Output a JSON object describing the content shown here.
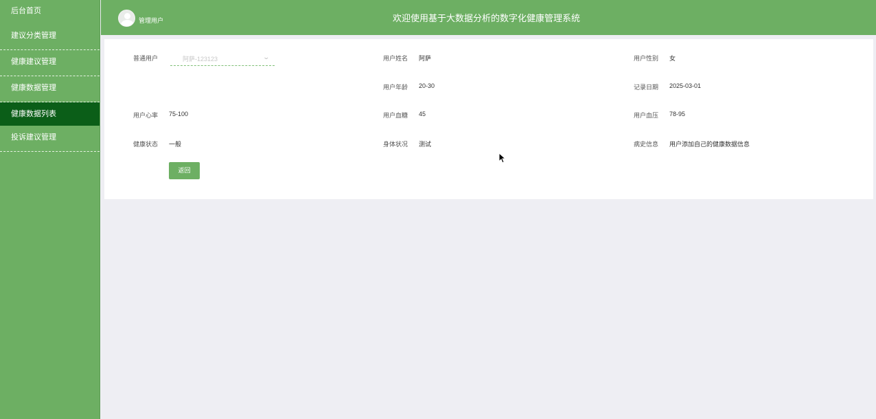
{
  "sidebar": {
    "items": [
      {
        "label": "后台首页"
      },
      {
        "label": "建议分类管理"
      },
      {
        "label": "健康建议管理"
      },
      {
        "label": "健康数据管理"
      },
      {
        "label": "健康数据列表"
      },
      {
        "label": "投诉建议管理"
      }
    ]
  },
  "header": {
    "user": "管理用户",
    "title": "欢迎使用基于大数据分析的数字化健康管理系统"
  },
  "form": {
    "user_label": "普通用户",
    "user_placeholder": "阿萨-123123",
    "name_label": "用户姓名",
    "name_value": "阿萨",
    "gender_label": "用户性别",
    "gender_value": "女",
    "age_label": "用户年龄",
    "age_value": "20-30",
    "date_label": "记录日期",
    "date_value": "2025-03-01",
    "heart_label": "用户心率",
    "heart_value": "75-100",
    "sugar_label": "用户血糖",
    "sugar_value": "45",
    "pressure_label": "用户血压",
    "pressure_value": "78-95",
    "status_label": "健康状态",
    "status_value": "一般",
    "body_label": "身体状况",
    "body_value": "测试",
    "history_label": "病史信息",
    "history_value": "用户添加自己的健康数据信息",
    "back_button": "返回"
  },
  "colors": {
    "primary": "#6daf63",
    "active": "#0b5e18",
    "background": "#eeeef3"
  }
}
